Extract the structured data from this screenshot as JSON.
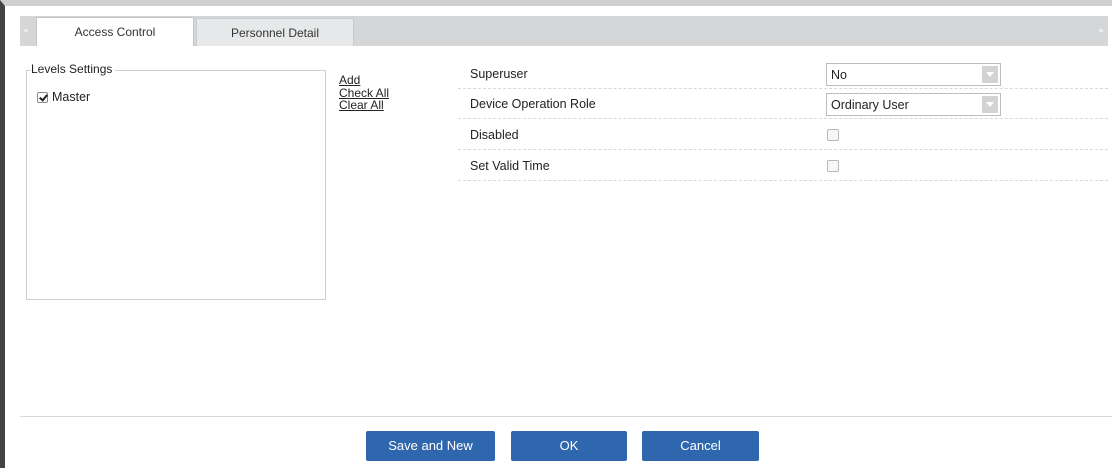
{
  "tabs": {
    "active": "Access Control",
    "inactive": "Personnel Detail",
    "left_arrow": "◂",
    "right_arrow": "▸"
  },
  "levels": {
    "legend": "Levels Settings",
    "items": [
      {
        "label": "Master",
        "checked": true
      }
    ]
  },
  "actions": {
    "add": "Add",
    "check_all": "Check All",
    "clear_all": "Clear All"
  },
  "form": {
    "superuser_label": "Superuser",
    "superuser_value": "No",
    "role_label": "Device Operation Role",
    "role_value": "Ordinary User",
    "disabled_label": "Disabled",
    "disabled_checked": false,
    "valid_time_label": "Set Valid Time",
    "valid_time_checked": false
  },
  "buttons": {
    "save_new": "Save and New",
    "ok": "OK",
    "cancel": "Cancel"
  },
  "colors": {
    "primary_button": "#2e67ad",
    "tab_strip": "#d4d6d8"
  }
}
